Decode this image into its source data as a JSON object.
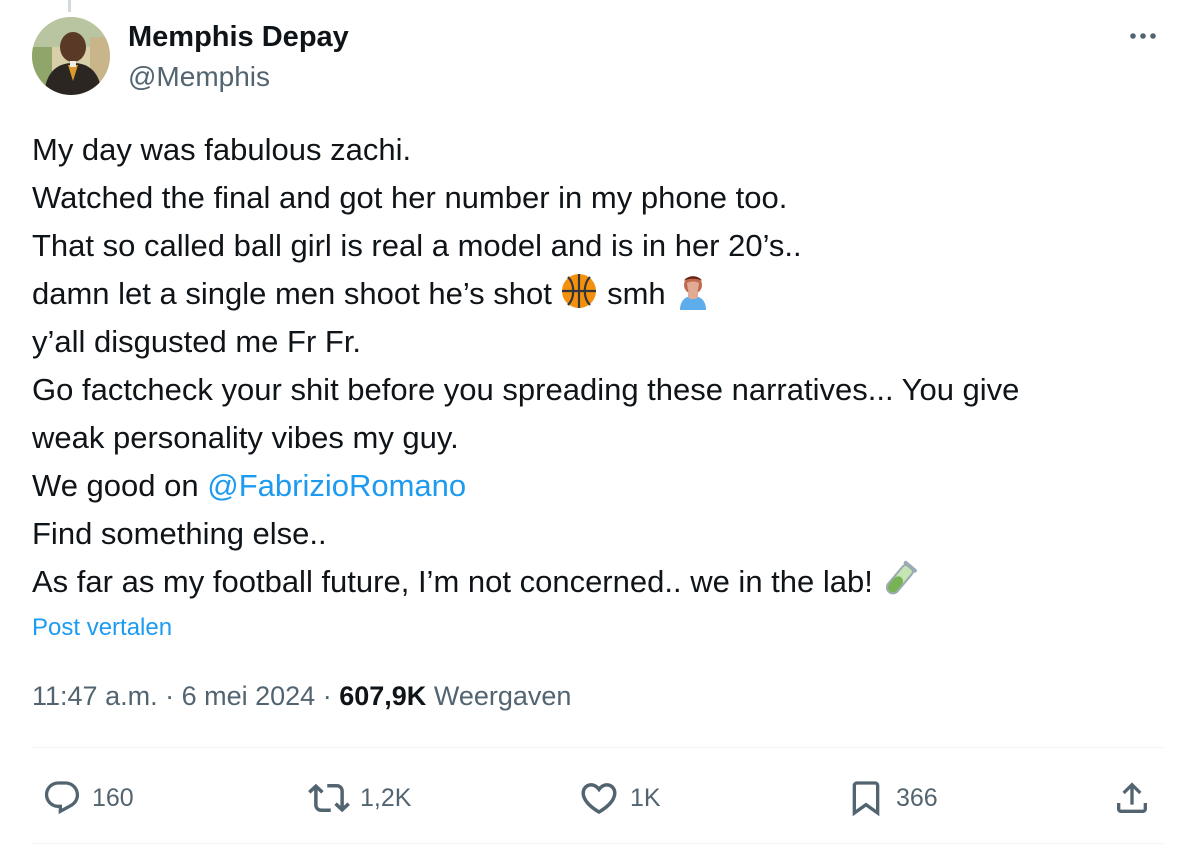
{
  "author": {
    "name": "Memphis Depay",
    "handle": "@Memphis",
    "avatar_icon": "profile-photo"
  },
  "more_icon": "more-horizontal-icon",
  "tweet": {
    "line1": "My day was fabulous zachi.",
    "line2": "Watched the final and got her number in my phone too.",
    "line3": "That so called ball girl is real a model and is in her 20’s..",
    "line4_pre": "damn let a single men shoot he’s shot ",
    "line4_mid": " smh ",
    "line5": "y’all disgusted me Fr Fr.",
    "line6": "Go factcheck your shit before you spreading these narratives... You give",
    "line7": "weak personality vibes my guy.",
    "line8_pre": "We good on ",
    "mention": "@FabrizioRomano",
    "line9": "Find something else..",
    "line10": "As far as my football future, I’m not concerned.. we in the lab! ",
    "emojis": [
      "basketball-emoji",
      "facepalm-emoji",
      "test-tube-emoji"
    ]
  },
  "translate_label": "Post vertalen",
  "meta": {
    "time": "11:47 a.m.",
    "separator": "·",
    "date": "6 mei 2024",
    "views_count": "607,9K",
    "views_label": "Weergaven"
  },
  "actions": {
    "replies": "160",
    "reposts": "1,2K",
    "likes": "1K",
    "bookmarks": "366"
  },
  "colors": {
    "accent": "#1d9bf0",
    "text": "#0f1419",
    "secondary": "#536471",
    "divider": "#eff3f4"
  }
}
